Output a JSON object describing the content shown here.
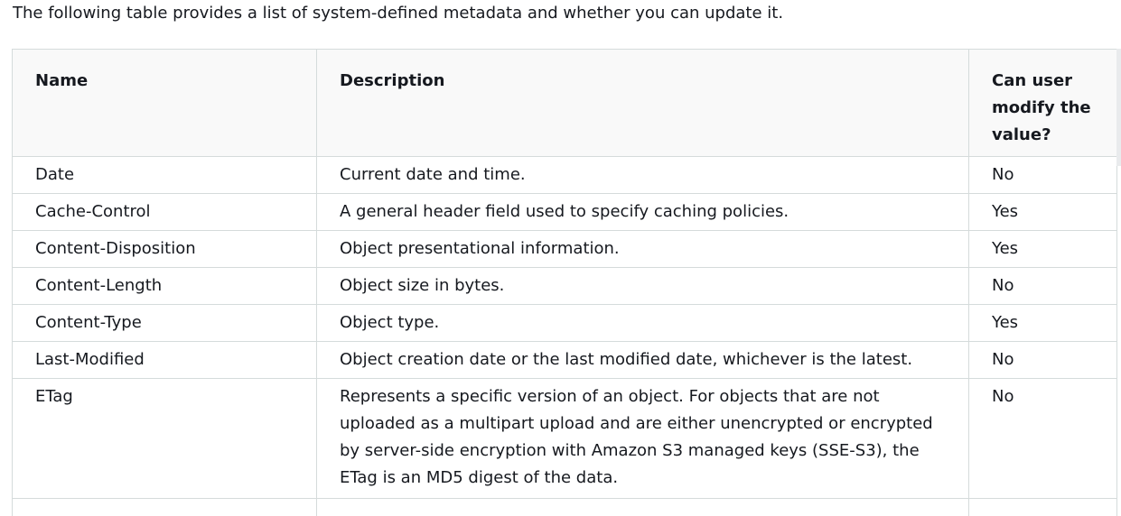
{
  "intro": "The following table provides a list of system-defined metadata and whether you can update it.",
  "table": {
    "headers": {
      "name": "Name",
      "description": "Description",
      "modifiable": "Can user modify the value?"
    },
    "rows": [
      {
        "name": "Date",
        "description": "Current date and time.",
        "modifiable": "No"
      },
      {
        "name": "Cache-Control",
        "description": "A general header field used to specify caching policies.",
        "modifiable": "Yes"
      },
      {
        "name": "Content-Disposition",
        "description": "Object presentational information.",
        "modifiable": "Yes"
      },
      {
        "name": "Content-Length",
        "description": "Object size in bytes.",
        "modifiable": "No"
      },
      {
        "name": "Content-Type",
        "description": "Object type.",
        "modifiable": "Yes"
      },
      {
        "name": "Last-Modified",
        "description": "Object creation date or the last modified date, whichever is the latest.",
        "modifiable": "No"
      },
      {
        "name": "ETag",
        "description": "Represents a specific version of an object. For objects that are not uploaded as a multipart upload and are either unencrypted or encrypted by server-side encryption with Amazon S3 managed keys (SSE-S3), the ETag is an MD5 digest of the data.",
        "modifiable": "No"
      }
    ]
  }
}
